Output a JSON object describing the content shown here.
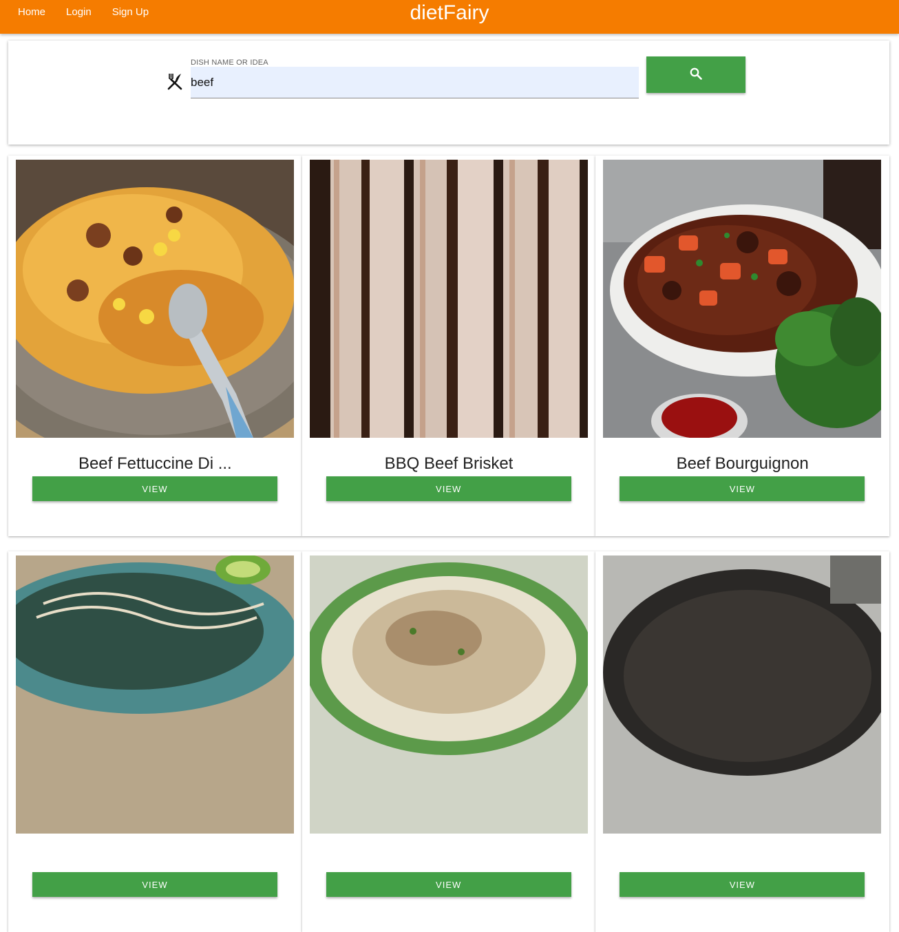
{
  "nav": {
    "links": [
      {
        "label": "Home"
      },
      {
        "label": "Login"
      },
      {
        "label": "Sign Up"
      }
    ],
    "brand": "dietFairy"
  },
  "search": {
    "label": "DISH NAME OR IDEA",
    "value": "beef",
    "icon": "silverware-icon",
    "button_icon": "search-icon"
  },
  "recipes": [
    {
      "title": "Beef Fettuccine Di ...",
      "button": "VIEW"
    },
    {
      "title": "BBQ Beef Brisket",
      "button": "VIEW"
    },
    {
      "title": "Beef Bourguignon",
      "button": "VIEW"
    },
    {
      "title": "",
      "button": "VIEW"
    },
    {
      "title": "",
      "button": "VIEW"
    },
    {
      "title": "",
      "button": "VIEW"
    }
  ],
  "colors": {
    "brand": "#f57c00",
    "action": "#43a047",
    "input_bg": "#e8f0fe"
  }
}
